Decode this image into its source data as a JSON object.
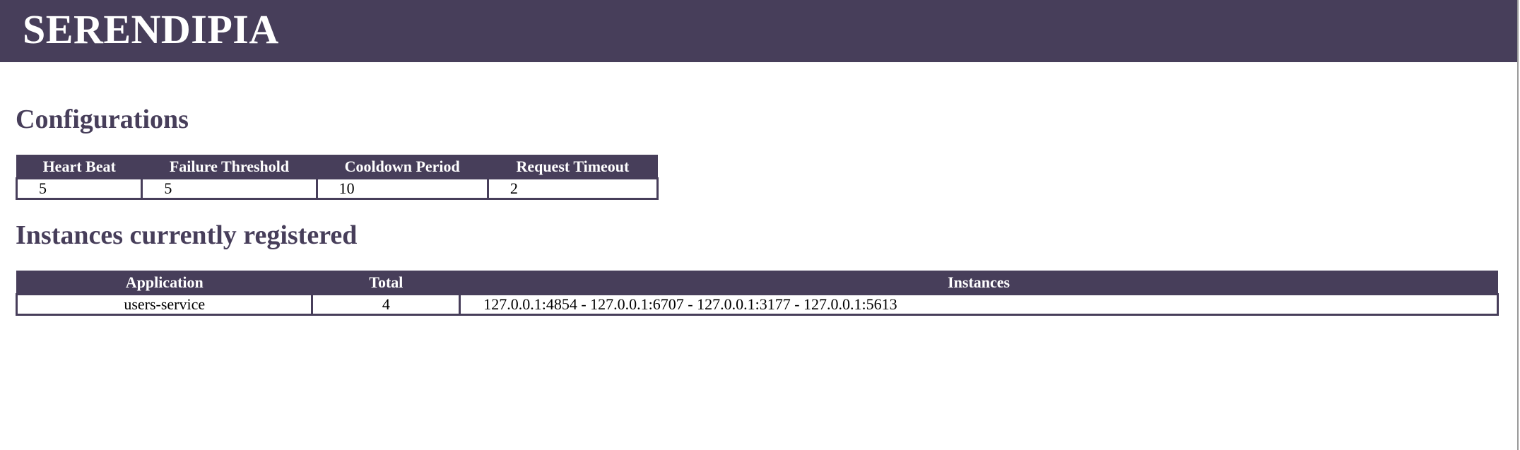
{
  "header": {
    "brand": "SERENDIPIA"
  },
  "configurations": {
    "title": "Configurations",
    "columns": [
      "Heart Beat",
      "Failure Threshold",
      "Cooldown Period",
      "Request Timeout"
    ],
    "values": [
      "5",
      "5",
      "10",
      "2"
    ]
  },
  "instances": {
    "title": "Instances currently registered",
    "columns": [
      "Application",
      "Total",
      "Instances"
    ],
    "rows": [
      {
        "application": "users-service",
        "total": "4",
        "instances": "127.0.0.1:4854 - 127.0.0.1:6707 - 127.0.0.1:3177 - 127.0.0.1:5613"
      }
    ]
  },
  "colors": {
    "accent": "#473e5a",
    "background": "#ffffff"
  }
}
